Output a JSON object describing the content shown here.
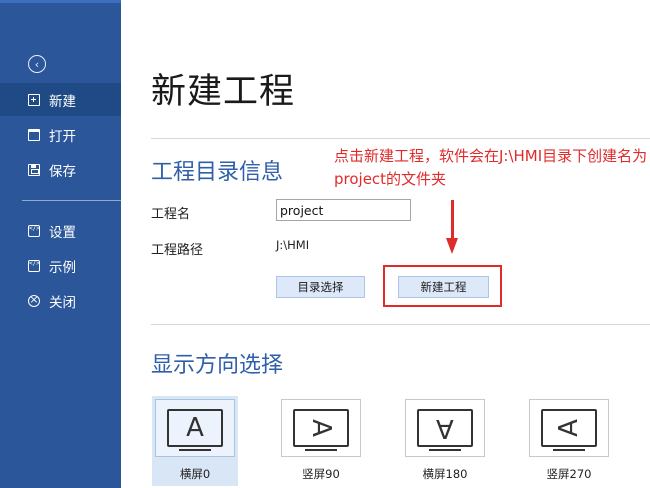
{
  "sidebar": {
    "items": [
      {
        "label": "新建",
        "icon": "new-file-icon",
        "active": true
      },
      {
        "label": "打开",
        "icon": "folder-open-icon"
      },
      {
        "label": "保存",
        "icon": "save-icon"
      },
      {
        "label": "设置",
        "icon": "settings-icon"
      },
      {
        "label": "示例",
        "icon": "example-icon"
      },
      {
        "label": "关闭",
        "icon": "close-icon"
      }
    ],
    "back_glyph": "‹"
  },
  "main": {
    "title": "新建工程",
    "project_section": {
      "title": "工程目录信息",
      "name_label": "工程名",
      "name_value": "project",
      "path_label": "工程路径",
      "path_value": "J:\\HMI",
      "dir_button": "目录选择",
      "new_button": "新建工程"
    },
    "annotation": "点击新建工程，软件会在J:\\HMI目录下创建名为project的文件夹",
    "orientation_section": {
      "title": "显示方向选择",
      "options": [
        {
          "label": "横屏0",
          "glyph": "A",
          "selected": true
        },
        {
          "label": "竖屏90",
          "glyph": "A"
        },
        {
          "label": "横屏180",
          "glyph": "A"
        },
        {
          "label": "竖屏270",
          "glyph": "A"
        }
      ]
    }
  },
  "colors": {
    "sidebar_bg": "#2b579a",
    "sidebar_active": "#1f4a85",
    "section_title": "#2f5faa",
    "annotation": "#e02b2b",
    "button_bg": "#dde9f8"
  }
}
